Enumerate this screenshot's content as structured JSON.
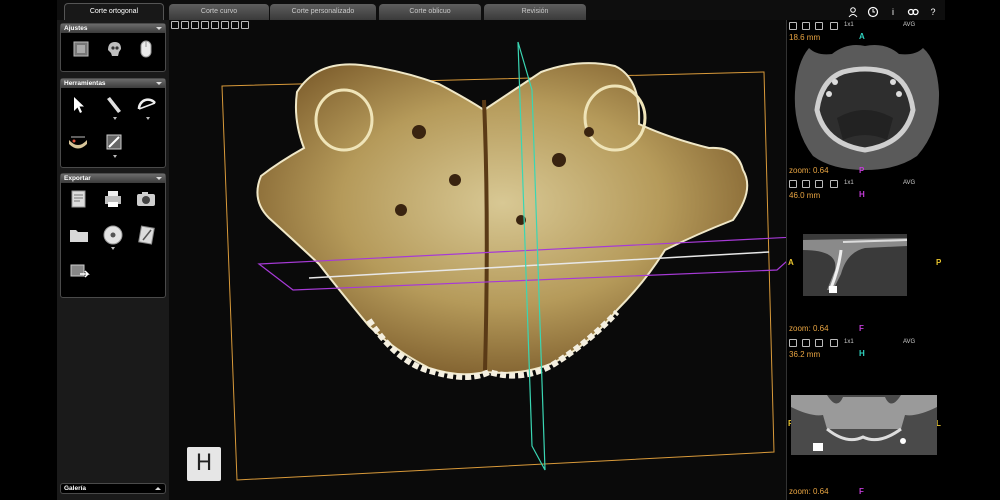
{
  "tabs": [
    {
      "label": "Corte ortogonal",
      "active": true
    },
    {
      "label": "Corte curvo",
      "active": false
    },
    {
      "label": "Corte personalizado",
      "active": false
    },
    {
      "label": "Corte oblicuo",
      "active": false
    },
    {
      "label": "Revisión",
      "active": false
    }
  ],
  "toolbar_icons": [
    "user-icon",
    "clock-icon",
    "info-icon",
    "link-icon",
    "help-icon"
  ],
  "toolbar_glyphs": {
    "info": "i",
    "help": "?"
  },
  "sidebar": {
    "ajustes": {
      "title": "Ajustes",
      "items": [
        "density-icon",
        "skull-icon",
        "mouse-icon"
      ]
    },
    "herramientas": {
      "title": "Herramientas",
      "items": [
        "pointer-icon",
        "ruler-icon",
        "protractor-icon",
        "jaw-icon",
        "pen-icon"
      ]
    },
    "exportar": {
      "title": "Exportar",
      "items": [
        "report-icon",
        "print-icon",
        "camera-icon",
        "folder-icon",
        "cd-icon",
        "notes-icon",
        "export-image-icon"
      ]
    },
    "galeria": {
      "title": "Galería"
    }
  },
  "viewport": {
    "orientation_label": "H"
  },
  "right_views": [
    {
      "thickness": "18.6 mm",
      "zoom": "zoom: 0.64",
      "top_marker": "A",
      "bottom_marker": "P",
      "left_marker": "R",
      "right_marker": "L",
      "scale_label": "1x1",
      "avg_label": "AVG"
    },
    {
      "thickness": "46.0 mm",
      "zoom": "zoom: 0.64",
      "top_marker": "H",
      "bottom_marker": "F",
      "left_marker": "A",
      "right_marker": "P",
      "scale_label": "1x1",
      "avg_label": "AVG"
    },
    {
      "thickness": "36.2 mm",
      "zoom": "zoom: 0.64",
      "top_marker": "H",
      "bottom_marker": "F",
      "left_marker": "R",
      "right_marker": "L",
      "scale_label": "1x1",
      "avg_label": "AVG"
    }
  ],
  "colors": {
    "accent_orange": "#e8a442",
    "marker_magenta": "#c23bd6",
    "marker_cyan": "#2fd3c0",
    "marker_yellow": "#e8c42e",
    "frame_orange": "#d99a3a",
    "plane_purple": "#a63ad6",
    "plane_cyan": "#3ad6b3"
  }
}
